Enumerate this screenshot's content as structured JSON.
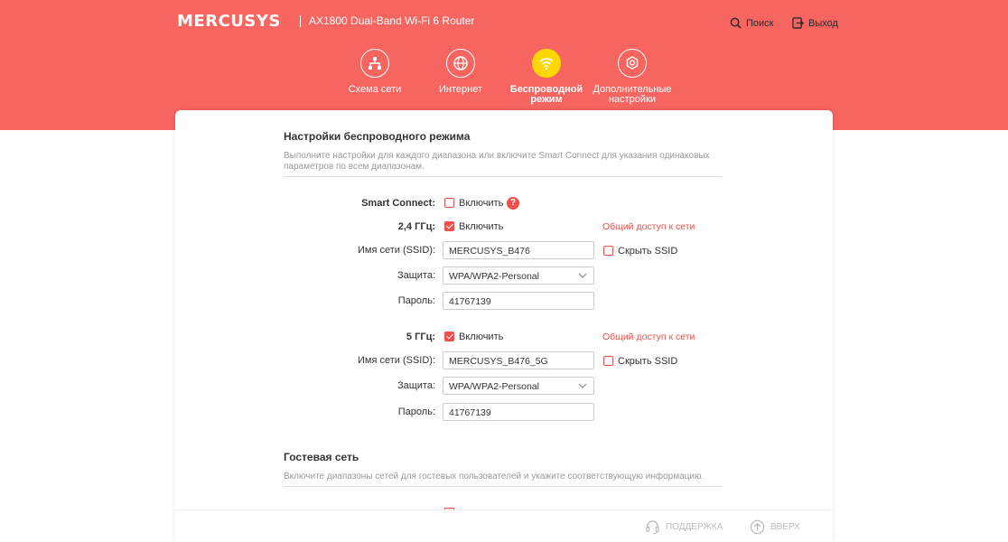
{
  "header": {
    "brand": "MERCUSYS",
    "separator": "|",
    "model": "AX1800 Dual-Band Wi-Fi 6 Router",
    "search_label": "Поиск",
    "logout_label": "Выход"
  },
  "nav": [
    {
      "label": "Схема сети",
      "icon": "network-map-icon"
    },
    {
      "label": "Интернет",
      "icon": "globe-icon"
    },
    {
      "label": "Беспроводной режим",
      "icon": "wifi-icon",
      "active": true
    },
    {
      "label": "Дополнительные настройки",
      "icon": "gear-icon"
    }
  ],
  "wireless": {
    "title": "Настройки беспроводного режима",
    "description": "Выполните настройки для каждого диапазона или включите Smart Connect для указания одинаковых параметров по всем диапазонам.",
    "smart_connect": {
      "label": "Smart Connect:",
      "option": "Включить",
      "checked": false,
      "help": "?"
    },
    "band24": {
      "label": "2,4 ГГц:",
      "enable": "Включить",
      "checked": true,
      "share": "Общий доступ к сети",
      "ssid_label": "Имя сети (SSID):",
      "ssid": "MERCUSYS_B476",
      "hide_ssid": "Скрыть SSID",
      "security_label": "Защита:",
      "security": "WPA/WPA2-Personal",
      "password_label": "Пароль:",
      "password": "41767139"
    },
    "band5": {
      "label": "5 ГГц:",
      "enable": "Включить",
      "checked": true,
      "share": "Общий доступ к сети",
      "ssid_label": "Имя сети (SSID):",
      "ssid": "MERCUSYS_B476_5G",
      "hide_ssid": "Скрыть SSID",
      "security_label": "Защита:",
      "security": "WPA/WPA2-Personal",
      "password_label": "Пароль:",
      "password": "41767139"
    }
  },
  "guest": {
    "title": "Гостевая сеть",
    "description": "Включите диапазоны сетей для гостевых пользователей и укажите соответствующую информацию."
  },
  "footer": {
    "support": "ПОДДЕРЖКА",
    "top": "ВВЕРХ"
  },
  "colors": {
    "brand_band": "#f76560",
    "accent": "#f0504a",
    "active_nav": "#ffd700"
  }
}
